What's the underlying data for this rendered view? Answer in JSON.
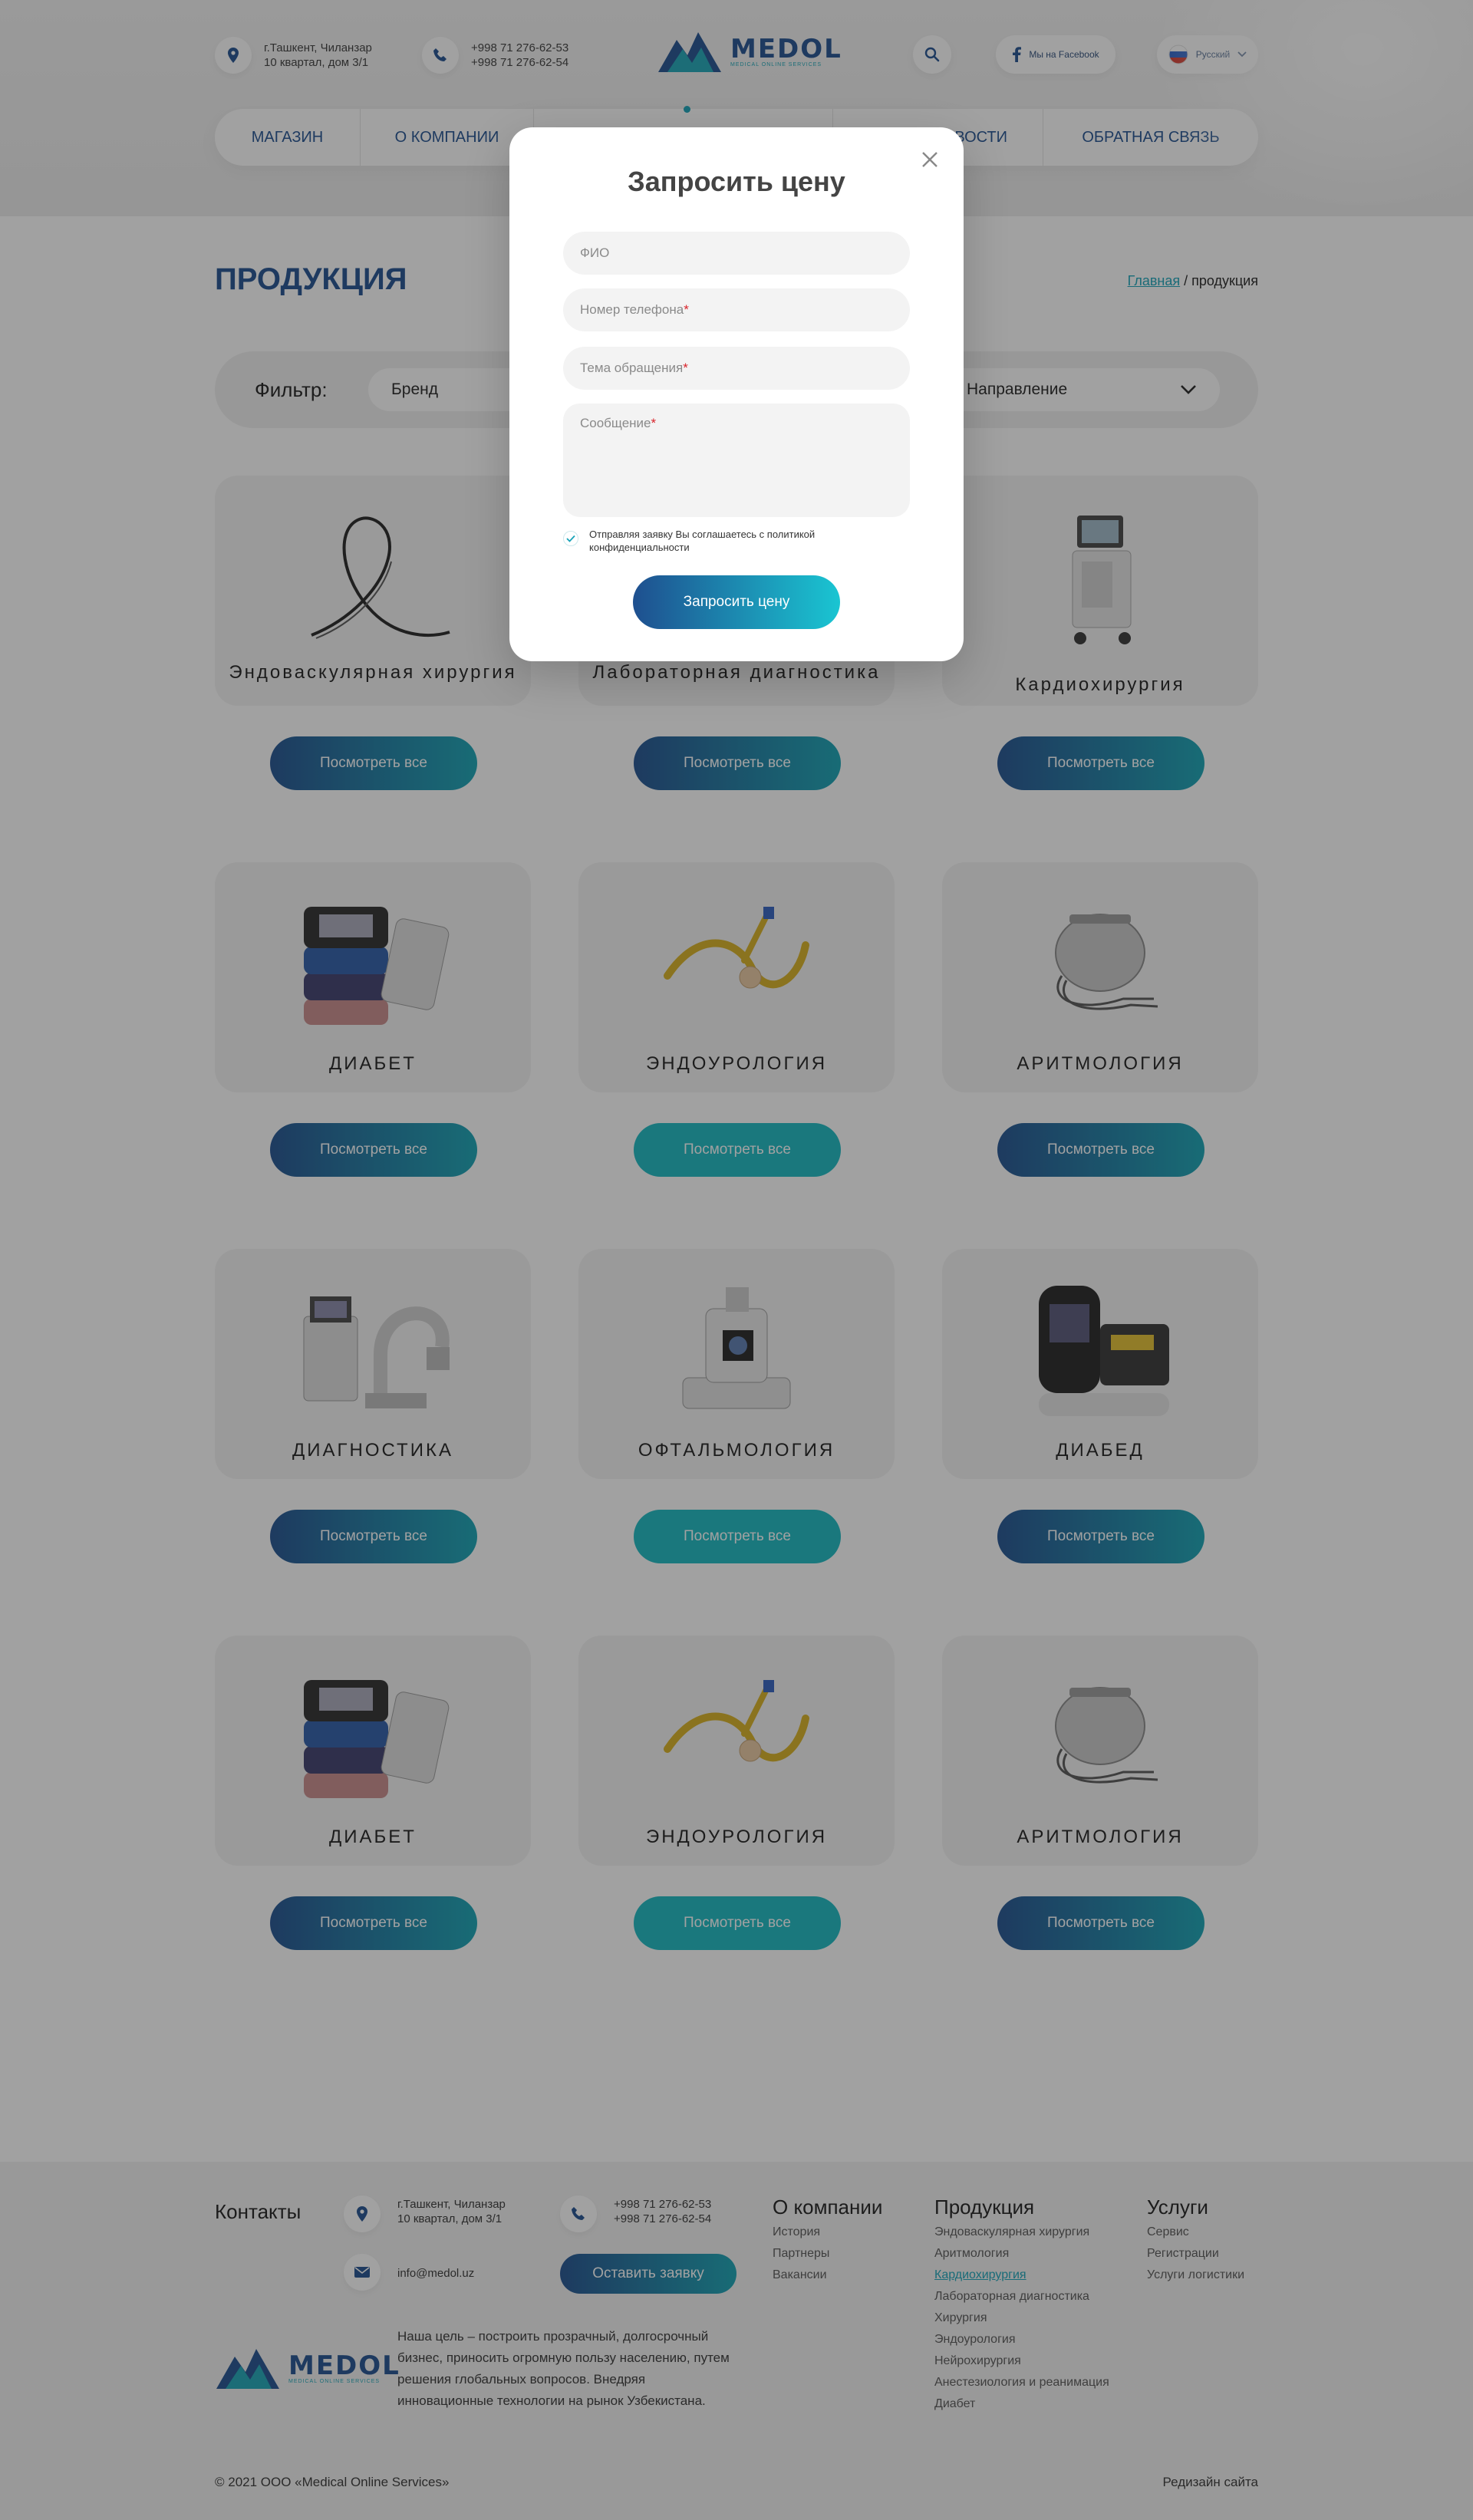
{
  "header": {
    "address_line1": "г.Ташкент, Чиланзар",
    "address_line2": "10 квартал, дом 3/1",
    "phone1": "+998 71 276-62-53",
    "phone2": "+998 71 276-62-54",
    "logo_text": "MEDOL",
    "logo_sub": "MEDICAL ONLINE SERVICES",
    "facebook_label": "Мы на Facebook",
    "language_label": "Русский"
  },
  "nav": {
    "items": [
      "Магазин",
      "О компании",
      "",
      "Новости",
      "Обратная связь"
    ],
    "visible_fragment": "ВОСТИ"
  },
  "page": {
    "title": "ПРОДУКЦИЯ",
    "breadcrumb_home": "Главная",
    "breadcrumb_sep": " / ",
    "breadcrumb_current": "продукция"
  },
  "filter": {
    "label": "Фильтр:",
    "brand": "Бренд",
    "direction": "Направление"
  },
  "products": [
    {
      "title": "Эндоваскулярная хирургия",
      "button": "Посмотреть все"
    },
    {
      "title": "Лабораторная диагностика",
      "button": "Посмотреть все"
    },
    {
      "title": "Кардиохирургия",
      "button": "Посмотреть все"
    },
    {
      "title": "ДИАБЕТ",
      "button": "Посмотреть все"
    },
    {
      "title": "ЭНДОУРОЛОГИЯ",
      "button": "Посмотреть все"
    },
    {
      "title": "АРИТМОЛОГИЯ",
      "button": "Посмотреть все"
    },
    {
      "title": "ДИАГНОСТИКА",
      "button": "Посмотреть все"
    },
    {
      "title": "ОФТАЛЬМОЛОГИЯ",
      "button": "Посмотреть все"
    },
    {
      "title": "ДИАБЕД",
      "button": "Посмотреть все"
    },
    {
      "title": "ДИАБЕТ",
      "button": "Посмотреть все"
    },
    {
      "title": "ЭНДОУРОЛОГИЯ",
      "button": "Посмотреть все"
    },
    {
      "title": "АРИТМОЛОГИЯ",
      "button": "Посмотреть все"
    }
  ],
  "modal": {
    "title": "Запросить цену",
    "fio_placeholder": "ФИО",
    "phone_placeholder": "Номер телефона",
    "topic_placeholder": "Тема обращения",
    "message_placeholder": "Сообщение",
    "required_mark": "*",
    "consent_text": "Отправляя заявку Вы соглашаетесь  с политикой конфиденциальности",
    "submit_label": "Запросить цену"
  },
  "footer": {
    "contacts_title": "Контакты",
    "address_line1": "г.Ташкент, Чиланзар",
    "address_line2": "10 квартал, дом 3/1",
    "phone1": "+998 71 276-62-53",
    "phone2": "+998 71 276-62-54",
    "email": "info@medol.uz",
    "request_button": "Оставить заявку",
    "about_title": "О компании",
    "about_links": [
      "История",
      "Партнеры",
      "Вакансии"
    ],
    "products_title": "Продукция",
    "products_links": [
      "Эндоваскулярная хирургия",
      "Аритмология",
      "Кардиохирургия",
      "Лабораторная диагностика",
      "Хирургия",
      "Эндоурология",
      "Нейрохирургия",
      "Анестезиология и реанимация",
      "Диабет"
    ],
    "services_title": "Услуги",
    "services_links": [
      "Сервис",
      "Регистрации",
      "Услуги логистики"
    ],
    "mission": "Наша цель – построить прозрачный, долгосрочный бизнес, приносить огромную пользу населению, путем решения глобальных вопросов. Внедряя инновационные технологии на рынок Узбекистана.",
    "copyright": "© 2021 ООО «Medical Online Services»",
    "redesign": "Редизайн сайта"
  },
  "colors": {
    "brand_blue": "#1e4f8f",
    "brand_teal": "#16a3b8",
    "button_teal": "#17b8c2",
    "required_red": "#d9242b"
  }
}
